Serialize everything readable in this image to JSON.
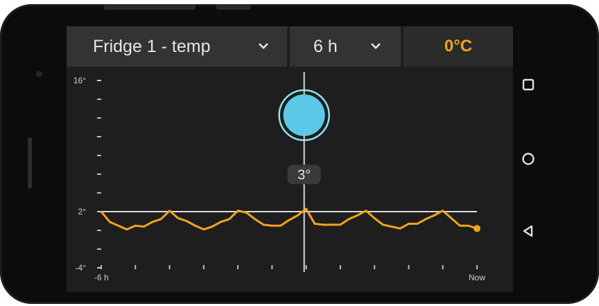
{
  "header": {
    "metric_select_label": "Fridge 1 - temp",
    "range_select_label": "6 h",
    "current_value": "0°C"
  },
  "colors": {
    "accent": "#f2a51a",
    "marker": "#5ac8e6",
    "marker_ring": "#8fe3ee",
    "screen_bg": "#1e1e1e",
    "toolbar_bg": "#333333"
  },
  "icons": {
    "metric_dropdown": "chevron-down-icon",
    "range_dropdown": "chevron-down-icon",
    "nav_recents": "square-icon",
    "nav_home": "circle-icon",
    "nav_back": "triangle-back-icon"
  },
  "chart_data": {
    "type": "line",
    "ylim": [
      -4,
      16
    ],
    "y_tick_labels": [
      "16°",
      "2°",
      "-4°"
    ],
    "y_labeled_ticks": [
      16,
      2,
      -4
    ],
    "y_minor_ticks": [
      14,
      12,
      10,
      8,
      6,
      4,
      0,
      -2
    ],
    "x_start_label": "-6 h",
    "x_end_label": "Now",
    "x_tick_count": 12,
    "reference_line": 2,
    "cursor": {
      "x_fraction": 0.54,
      "value": 3,
      "label": "3°"
    },
    "series": [
      {
        "values": [
          2,
          0.9,
          0.5,
          0.1,
          0.5,
          0.4,
          0.9,
          1.2,
          2.1,
          1.3,
          1.0,
          0.5,
          0.1,
          0.4,
          0.9,
          1.2,
          2.1,
          1.9,
          1.2,
          0.6,
          0.5,
          0.5,
          1.1,
          1.6,
          2.3,
          0.7,
          0.6,
          0.6,
          0.6,
          1.2,
          1.6,
          2.1,
          1.3,
          0.6,
          0.4,
          0.2,
          0.7,
          0.7,
          1.2,
          1.6,
          2.1,
          1.3,
          0.5,
          0.5,
          0.2
        ]
      }
    ]
  }
}
